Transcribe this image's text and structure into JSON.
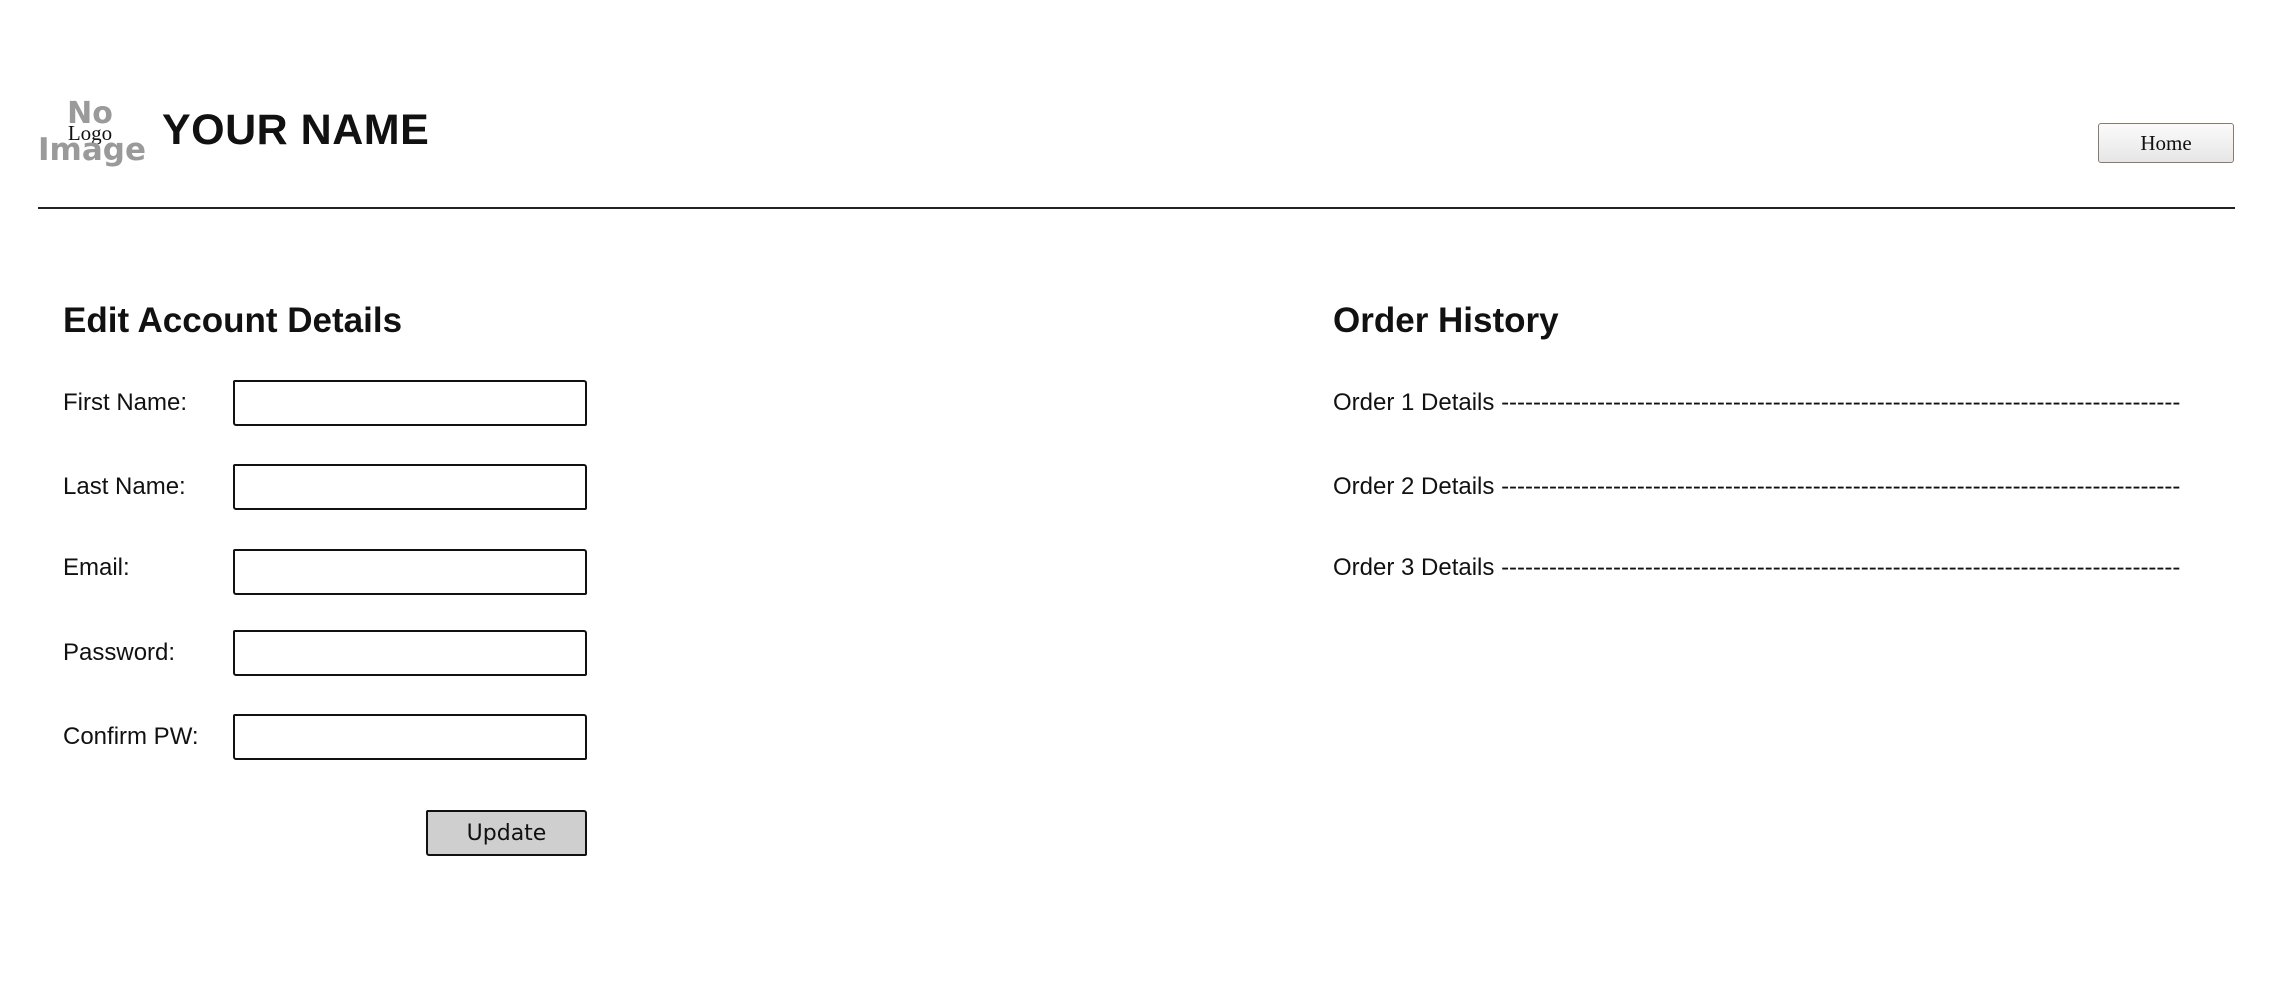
{
  "header": {
    "logo": {
      "no_text": "No",
      "logo_text": "Logo",
      "image_text": "Image"
    },
    "site_name": "YOUR NAME",
    "home_label": "Home"
  },
  "edit_account": {
    "heading": "Edit Account Details",
    "fields": [
      {
        "label": "First Name:",
        "value": ""
      },
      {
        "label": "Last Name:",
        "value": ""
      },
      {
        "label": "Email:",
        "value": ""
      },
      {
        "label": "Password:",
        "value": ""
      },
      {
        "label": "Confirm PW:",
        "value": ""
      }
    ],
    "update_label": "Update"
  },
  "order_history": {
    "heading": "Order History",
    "orders": [
      {
        "label": "Order 1 Details",
        "dashes": "-------------------------------------------------------------------------------------"
      },
      {
        "label": "Order 2 Details",
        "dashes": "-------------------------------------------------------------------------------------"
      },
      {
        "label": "Order 3 Details",
        "dashes": "-------------------------------------------------------------------------------------"
      }
    ]
  }
}
